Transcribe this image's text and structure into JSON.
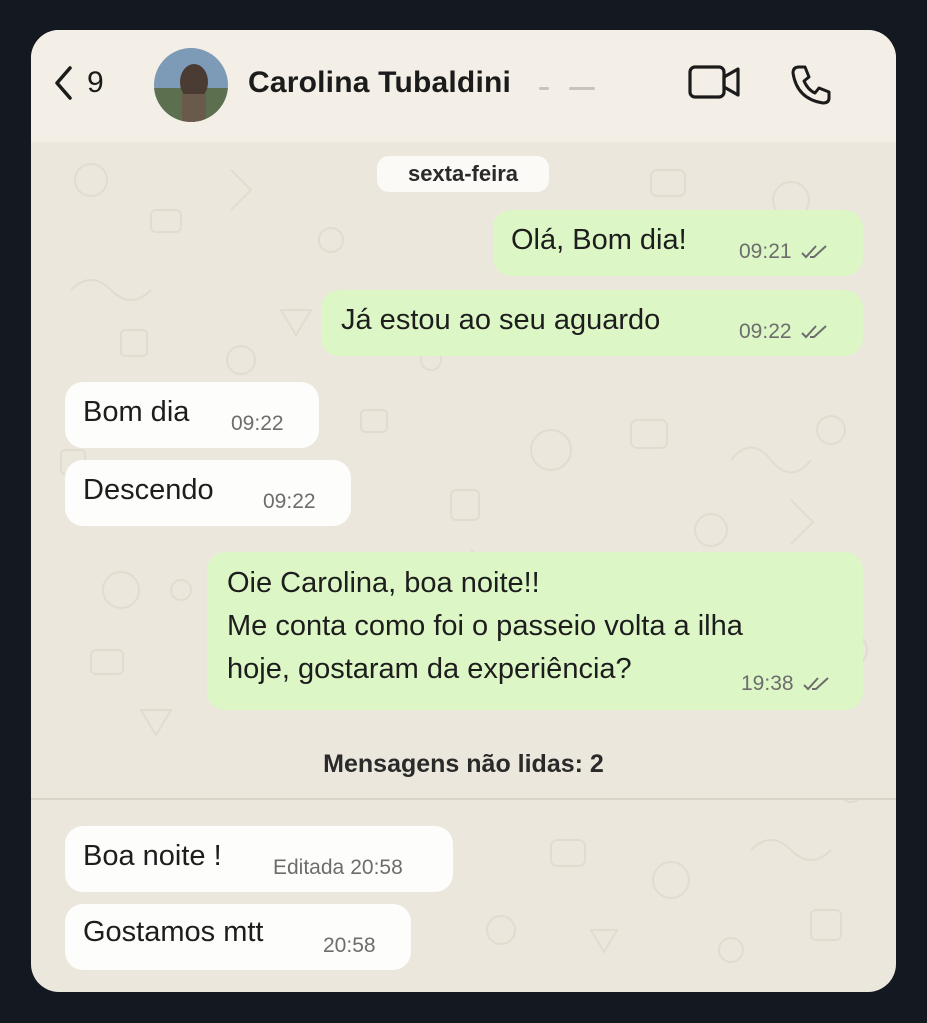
{
  "header": {
    "back_count": "9",
    "contact_name": "Carolina Tubaldini"
  },
  "chat": {
    "date_separator": "sexta-feira",
    "unread_label": "Mensagens não lidas: 2",
    "messages": [
      {
        "direction": "outgoing",
        "text": "Olá, Bom dia!",
        "time": "09:21",
        "status": "read"
      },
      {
        "direction": "outgoing",
        "text": "Já estou ao seu aguardo",
        "time": "09:22",
        "status": "read"
      },
      {
        "direction": "incoming",
        "text": "Bom dia",
        "time": "09:22"
      },
      {
        "direction": "incoming",
        "text": "Descendo",
        "time": "09:22"
      },
      {
        "direction": "outgoing",
        "lines": [
          "Oie Carolina, boa noite!!",
          "Me conta como foi o passeio volta a ilha",
          "hoje, gostaram da experiência?"
        ],
        "time": "19:38",
        "status": "read"
      },
      {
        "direction": "incoming",
        "text": "Boa noite !",
        "edited_label": "Editada",
        "time": "20:58"
      },
      {
        "direction": "incoming",
        "text": "Gostamos mtt",
        "time": "20:58"
      }
    ]
  },
  "colors": {
    "outgoing_bubble": "#dcf7c5",
    "incoming_bubble": "#fdfdfc",
    "wallpaper": "#ece7dd"
  }
}
